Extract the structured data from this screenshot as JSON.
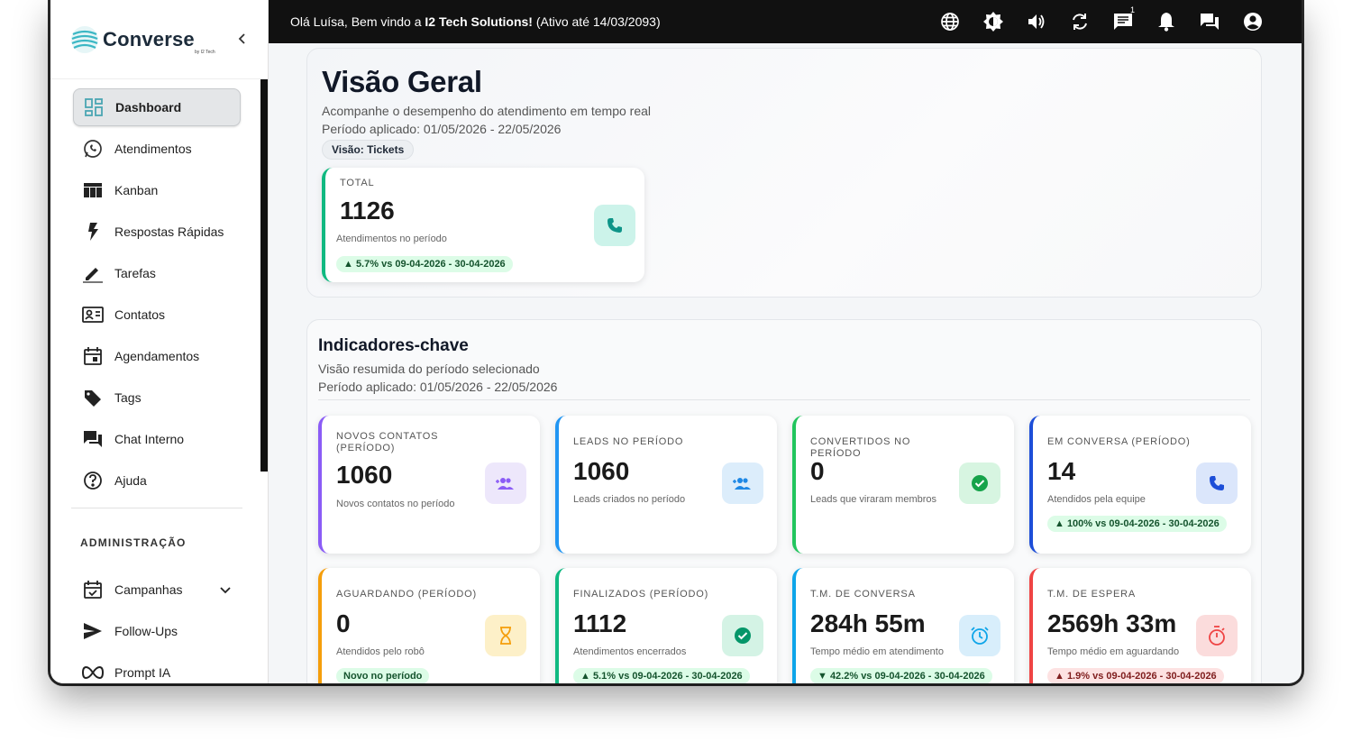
{
  "brand": {
    "name": "Converse",
    "sub": "by I2 Tech"
  },
  "topbar": {
    "greeting_prefix": "Olá Luísa, Bem vindo a ",
    "greeting_company": "I2 Tech Solutions!",
    "greeting_suffix": " (Ativo até 14/03/2093)",
    "chat_badge": "1"
  },
  "sidebar": {
    "items": [
      {
        "label": "Dashboard"
      },
      {
        "label": "Atendimentos"
      },
      {
        "label": "Kanban"
      },
      {
        "label": "Respostas Rápidas"
      },
      {
        "label": "Tarefas"
      },
      {
        "label": "Contatos"
      },
      {
        "label": "Agendamentos"
      },
      {
        "label": "Tags"
      },
      {
        "label": "Chat Interno"
      },
      {
        "label": "Ajuda"
      }
    ],
    "section_title": "ADMINISTRAÇÃO",
    "admin_items": [
      {
        "label": "Campanhas"
      },
      {
        "label": "Follow-Ups"
      },
      {
        "label": "Prompt IA"
      }
    ]
  },
  "overview": {
    "title": "Visão Geral",
    "subtitle": "Acompanhe o desempenho do atendimento em tempo real",
    "period": "Período aplicado: 01/05/2026 - 22/05/2026",
    "chip": "Visão: Tickets",
    "total_card": {
      "label": "TOTAL",
      "value": "1126",
      "desc": "Atendimentos no período",
      "trend": "▲ 5.7% vs 09-04-2026 - 30-04-2026"
    }
  },
  "kpi": {
    "title": "Indicadores-chave",
    "subtitle": "Visão resumida do período selecionado",
    "period": "Período aplicado: 01/05/2026 - 22/05/2026",
    "cards": [
      {
        "label": "NOVOS CONTATOS (PERÍODO)",
        "value": "1060",
        "desc": "Novos contatos no período",
        "trend": ""
      },
      {
        "label": "LEADS NO PERÍODO",
        "value": "1060",
        "desc": "Leads criados no período",
        "trend": ""
      },
      {
        "label": "CONVERTIDOS NO PERÍODO",
        "value": "0",
        "desc": "Leads que viraram membros",
        "trend": ""
      },
      {
        "label": "EM CONVERSA (PERÍODO)",
        "value": "14",
        "desc": "Atendidos pela equipe",
        "trend": "▲ 100% vs 09-04-2026 - 30-04-2026"
      },
      {
        "label": "AGUARDANDO (PERÍODO)",
        "value": "0",
        "desc": "Atendidos pelo robô",
        "trend": "Novo no período"
      },
      {
        "label": "FINALIZADOS (PERÍODO)",
        "value": "1112",
        "desc": "Atendimentos encerrados",
        "trend": "▲ 5.1% vs 09-04-2026 - 30-04-2026"
      },
      {
        "label": "T.M. DE CONVERSA",
        "value": "284h 55m",
        "desc": "Tempo médio em atendimento",
        "trend": "▼ 42.2% vs 09-04-2026 - 30-04-2026"
      },
      {
        "label": "T.M. DE ESPERA",
        "value": "2569h 33m",
        "desc": "Tempo médio em aguardando",
        "trend": "▲ 1.9% vs 09-04-2026 - 30-04-2026"
      }
    ]
  },
  "colors": {
    "purple": "#8b5cf6",
    "blue": "#2196f3",
    "green": "#22c55e",
    "navy": "#1d4ed8",
    "orange": "#f59e0b",
    "teal": "#10b981",
    "sky": "#0ea5e9",
    "red": "#ef4444"
  }
}
